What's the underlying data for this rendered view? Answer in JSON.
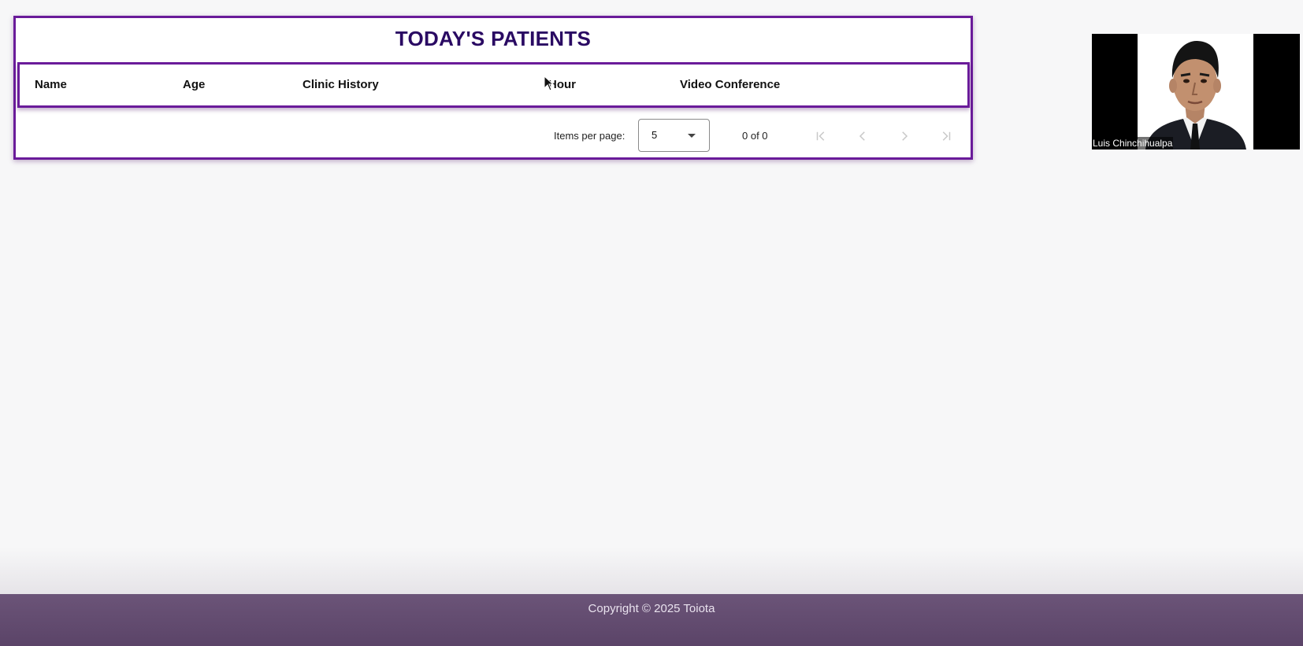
{
  "patients_card": {
    "title": "TODAY'S PATIENTS",
    "columns": [
      "Name",
      "Age",
      "Clinic History",
      "Hour",
      "Video Conference"
    ],
    "rows": []
  },
  "paginator": {
    "items_per_page_label": "Items per page:",
    "page_size": "5",
    "range_label": "0 of 0",
    "buttons": {
      "first": "first-page-icon",
      "previous": "previous-page-icon",
      "next": "next-page-icon",
      "last": "last-page-icon"
    }
  },
  "video_tile": {
    "participant_name": "Luis Chinchihualpa"
  },
  "footer": {
    "copyright": "Copyright © 2025 Toiota"
  },
  "colors": {
    "accent": "#6a1b9a",
    "title": "#2a0a63",
    "footer": "#5b4468",
    "disabled_icon": "#c8c8c8"
  }
}
